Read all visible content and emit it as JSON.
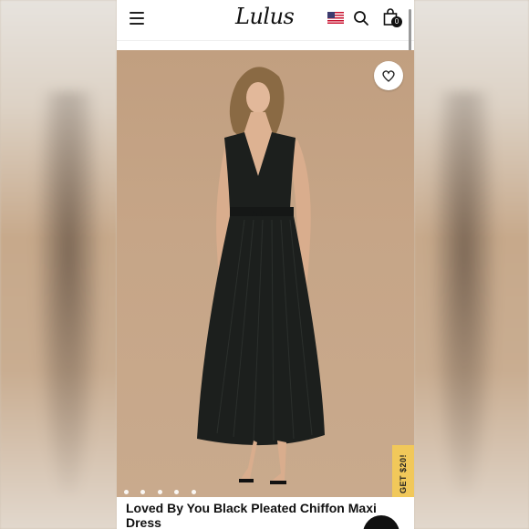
{
  "header": {
    "logo": "Lulus",
    "cart_count": "0",
    "icons": [
      "hamburger-menu-icon",
      "us-flag-icon",
      "search-icon",
      "shopping-bag-icon"
    ]
  },
  "hero": {
    "carousel_dots": 5,
    "active_dot": 4,
    "wishlist_icon": "heart-icon",
    "promo_tab": "GET $20!"
  },
  "product": {
    "title": "Loved By You Black Pleated Chiffon Maxi Dress"
  },
  "colors": {
    "promo": "#f1c85a",
    "dress": "#1c1f1d",
    "backdrop": "#c6a587"
  }
}
